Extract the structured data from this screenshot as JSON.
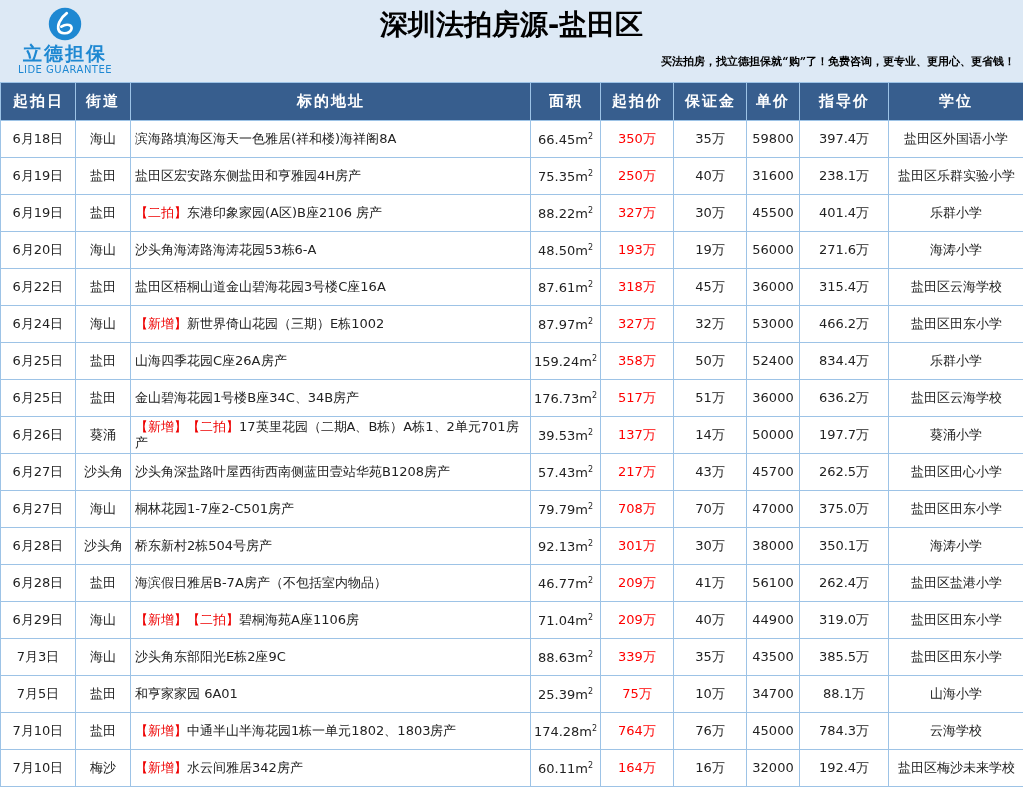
{
  "header": {
    "logo": {
      "name_cn": "立德担保",
      "name_en": "LIDE GUARANTEE"
    },
    "title": "深圳法拍房源-盐田区",
    "slogan": "买法拍房，找立德担保就“购”了！免费咨询，更专业、更用心、更省钱！"
  },
  "table": {
    "columns": [
      "起拍日",
      "街道",
      "标的地址",
      "面积",
      "起拍价",
      "保证金",
      "单价",
      "指导价",
      "学位"
    ],
    "rows": [
      {
        "date": "6月18日",
        "street": "海山",
        "tags": [],
        "address": "滨海路填海区海天一色雅居(祥和楼)海祥阁8A",
        "area": "66.45m$^{2}$",
        "start_price": "350万",
        "deposit": "35万",
        "unit_price": "59800",
        "guide_price": "397.4万",
        "school": "盐田区外国语小学"
      },
      {
        "date": "6月19日",
        "street": "盐田",
        "tags": [],
        "address": "盐田区宏安路东侧盐田和亨雅园4H房产",
        "area": "75.35m$^{2}$",
        "start_price": "250万",
        "deposit": "40万",
        "unit_price": "31600",
        "guide_price": "238.1万",
        "school": "盐田区乐群实验小学"
      },
      {
        "date": "6月19日",
        "street": "盐田",
        "tags": [
          "【二拍】"
        ],
        "address": "东港印象家园(A区)B座2106 房产",
        "area": "88.22m$^{2}$",
        "start_price": "327万",
        "deposit": "30万",
        "unit_price": "45500",
        "guide_price": "401.4万",
        "school": "乐群小学"
      },
      {
        "date": "6月20日",
        "street": "海山",
        "tags": [],
        "address": "沙头角海涛路海涛花园53栋6-A",
        "area": "48.50m$^{2}$",
        "start_price": "193万",
        "deposit": "19万",
        "unit_price": "56000",
        "guide_price": "271.6万",
        "school": "海涛小学"
      },
      {
        "date": "6月22日",
        "street": "盐田",
        "tags": [],
        "address": "盐田区梧桐山道金山碧海花园3号楼C座16A",
        "area": "87.61m$^{2}$",
        "start_price": "318万",
        "deposit": "45万",
        "unit_price": "36000",
        "guide_price": "315.4万",
        "school": "盐田区云海学校"
      },
      {
        "date": "6月24日",
        "street": "海山",
        "tags": [
          "【新增】"
        ],
        "address": "新世界倚山花园（三期）E栋1002",
        "area": "87.97m$^{2}$",
        "start_price": "327万",
        "deposit": "32万",
        "unit_price": "53000",
        "guide_price": "466.2万",
        "school": "盐田区田东小学"
      },
      {
        "date": "6月25日",
        "street": "盐田",
        "tags": [],
        "address": "山海四季花园C座26A房产",
        "area": "159.24m$^{2}$",
        "start_price": "358万",
        "deposit": "50万",
        "unit_price": "52400",
        "guide_price": "834.4万",
        "school": "乐群小学"
      },
      {
        "date": "6月25日",
        "street": "盐田",
        "tags": [],
        "address": "金山碧海花园1号楼B座34C、34B房产",
        "area": "176.73m$^{2}$",
        "start_price": "517万",
        "deposit": "51万",
        "unit_price": "36000",
        "guide_price": "636.2万",
        "school": "盐田区云海学校"
      },
      {
        "date": "6月26日",
        "street": "葵涌",
        "tags": [
          "【新增】",
          "【二拍】"
        ],
        "address": "17英里花园（二期A、B栋）A栋1、2单元701房产",
        "area": "39.53m$^{2}$",
        "start_price": "137万",
        "deposit": "14万",
        "unit_price": "50000",
        "guide_price": "197.7万",
        "school": "葵涌小学"
      },
      {
        "date": "6月27日",
        "street": "沙头角",
        "tags": [],
        "address": "沙头角深盐路叶屋西街西南侧蓝田壹站华苑B1208房产",
        "area": "57.43m$^{2}$",
        "start_price": "217万",
        "deposit": "43万",
        "unit_price": "45700",
        "guide_price": "262.5万",
        "school": "盐田区田心小学"
      },
      {
        "date": "6月27日",
        "street": "海山",
        "tags": [],
        "address": "桐林花园1-7座2-C501房产",
        "area": "79.79m$^{2}$",
        "start_price": "708万",
        "deposit": "70万",
        "unit_price": "47000",
        "guide_price": "375.0万",
        "school": "盐田区田东小学"
      },
      {
        "date": "6月28日",
        "street": "沙头角",
        "tags": [],
        "address": "桥东新村2栋504号房产",
        "area": "92.13m$^{2}$",
        "start_price": "301万",
        "deposit": "30万",
        "unit_price": "38000",
        "guide_price": "350.1万",
        "school": "海涛小学"
      },
      {
        "date": "6月28日",
        "street": "盐田",
        "tags": [],
        "address": "海滨假日雅居B-7A房产（不包括室内物品）",
        "area": "46.77m$^{2}$",
        "start_price": "209万",
        "deposit": "41万",
        "unit_price": "56100",
        "guide_price": "262.4万",
        "school": "盐田区盐港小学"
      },
      {
        "date": "6月29日",
        "street": "海山",
        "tags": [
          "【新增】",
          "【二拍】"
        ],
        "address": "碧桐海苑A座1106房",
        "area": "71.04m$^{2}$",
        "start_price": "209万",
        "deposit": "40万",
        "unit_price": "44900",
        "guide_price": "319.0万",
        "school": "盐田区田东小学"
      },
      {
        "date": "7月3日",
        "street": "海山",
        "tags": [],
        "address": "沙头角东部阳光E栋2座9C",
        "area": "88.63m$^{2}$",
        "start_price": "339万",
        "deposit": "35万",
        "unit_price": "43500",
        "guide_price": "385.5万",
        "school": "盐田区田东小学"
      },
      {
        "date": "7月5日",
        "street": "盐田",
        "tags": [],
        "address": "和亨家家园 6A01",
        "area": "25.39m$^{2}$",
        "start_price": "75万",
        "deposit": "10万",
        "unit_price": "34700",
        "guide_price": "88.1万",
        "school": "山海小学"
      },
      {
        "date": "7月10日",
        "street": "盐田",
        "tags": [
          "【新增】"
        ],
        "address": "中通半山半海花园1栋一单元1802、1803房产",
        "area": "174.28m$^{2}$",
        "start_price": "764万",
        "deposit": "76万",
        "unit_price": "45000",
        "guide_price": "784.3万",
        "school": "云海学校"
      },
      {
        "date": "7月10日",
        "street": "梅沙",
        "tags": [
          "【新增】"
        ],
        "address": "水云间雅居342房产",
        "area": "60.11m$^{2}$",
        "start_price": "164万",
        "deposit": "16万",
        "unit_price": "32000",
        "guide_price": "192.4万",
        "school": "盐田区梅沙未来学校"
      }
    ]
  }
}
